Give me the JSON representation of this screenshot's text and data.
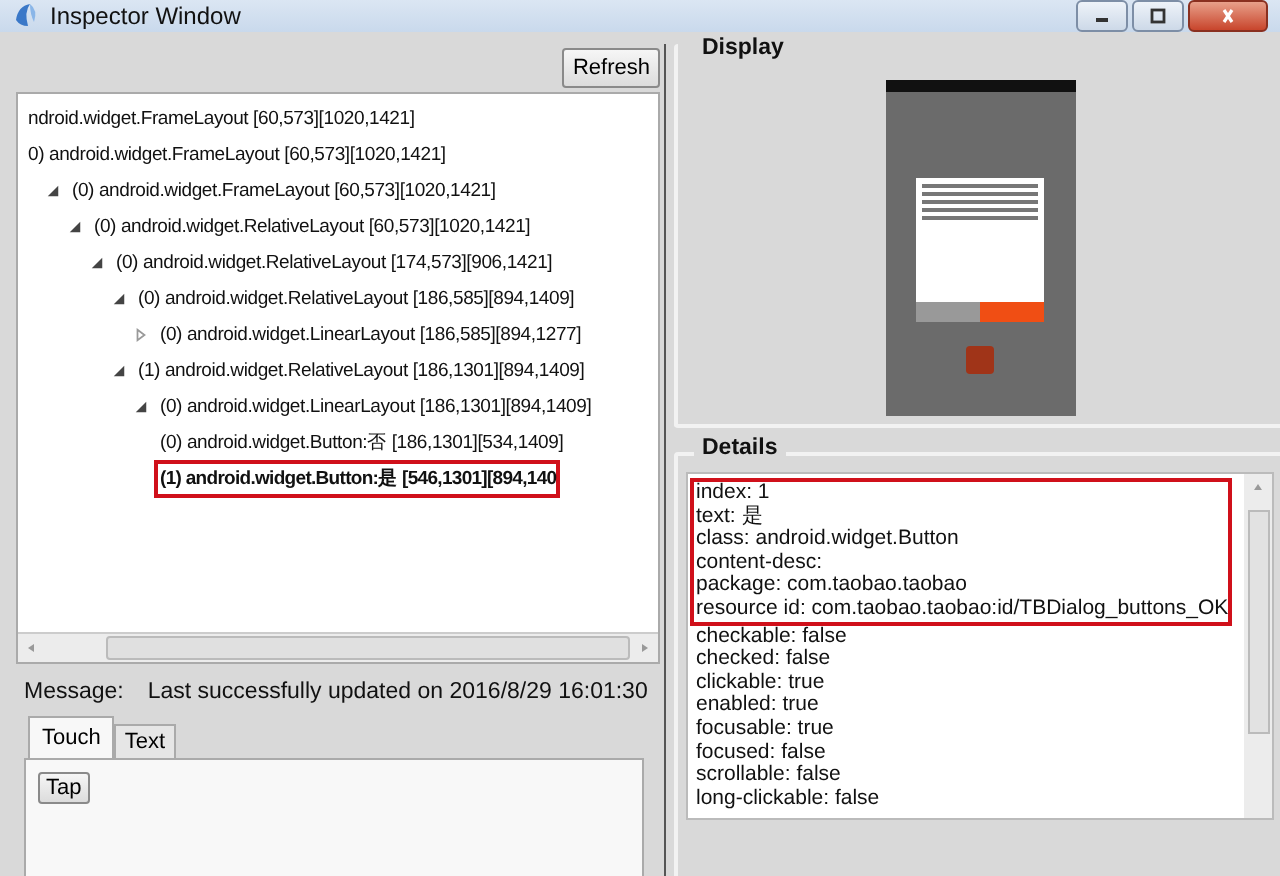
{
  "window": {
    "title": "Inspector Window"
  },
  "refresh_button": "Refresh",
  "tree": [
    {
      "label": "ndroid.widget.FrameLayout [60,573][1020,1421]",
      "selected": false,
      "children": [
        {
          "label": "0) android.widget.FrameLayout [60,573][1020,1421]",
          "selected": false,
          "children": [
            {
              "label": "(0) android.widget.FrameLayout [60,573][1020,1421]",
              "expanded": true,
              "selected": false,
              "children": [
                {
                  "label": "(0) android.widget.RelativeLayout [60,573][1020,1421]",
                  "expanded": true,
                  "selected": false,
                  "children": [
                    {
                      "label": "(0) android.widget.RelativeLayout [174,573][906,1421]",
                      "expanded": true,
                      "selected": false,
                      "children": [
                        {
                          "label": "(0) android.widget.RelativeLayout [186,585][894,1409]",
                          "expanded": true,
                          "selected": false,
                          "children": [
                            {
                              "label": "(0) android.widget.LinearLayout [186,585][894,1277]",
                              "expanded": false,
                              "selected": false
                            }
                          ]
                        },
                        {
                          "label": "(1) android.widget.RelativeLayout [186,1301][894,1409]",
                          "expanded": true,
                          "selected": false,
                          "children": [
                            {
                              "label": "(0) android.widget.LinearLayout [186,1301][894,1409]",
                              "expanded": true,
                              "selected": false,
                              "children": [
                                {
                                  "label": "(0) android.widget.Button:否 [186,1301][534,1409]",
                                  "selected": false
                                },
                                {
                                  "label": "(1) android.widget.Button:是 [546,1301][894,140",
                                  "selected": true
                                }
                              ]
                            }
                          ]
                        }
                      ]
                    }
                  ]
                }
              ]
            }
          ]
        }
      ]
    }
  ],
  "message": {
    "label": "Message:",
    "text": "Last successfully updated on 2016/8/29 16:01:30"
  },
  "tabs": [
    {
      "label": "Touch",
      "selected": true
    },
    {
      "label": "Text",
      "selected": false
    }
  ],
  "tap_button": "Tap",
  "display": {
    "title": "Display"
  },
  "details": {
    "title": "Details",
    "highlighted_lines": [
      "index: 1",
      "text: 是",
      "class: android.widget.Button",
      "content-desc:",
      "package: com.taobao.taobao",
      "resource id: com.taobao.taobao:id/TBDialog_buttons_OK"
    ],
    "lines": [
      "checkable: false",
      "checked: false",
      "clickable: true",
      "enabled: true",
      "focusable: true",
      "focused: false",
      "scrollable: false",
      "long-clickable: false"
    ]
  }
}
